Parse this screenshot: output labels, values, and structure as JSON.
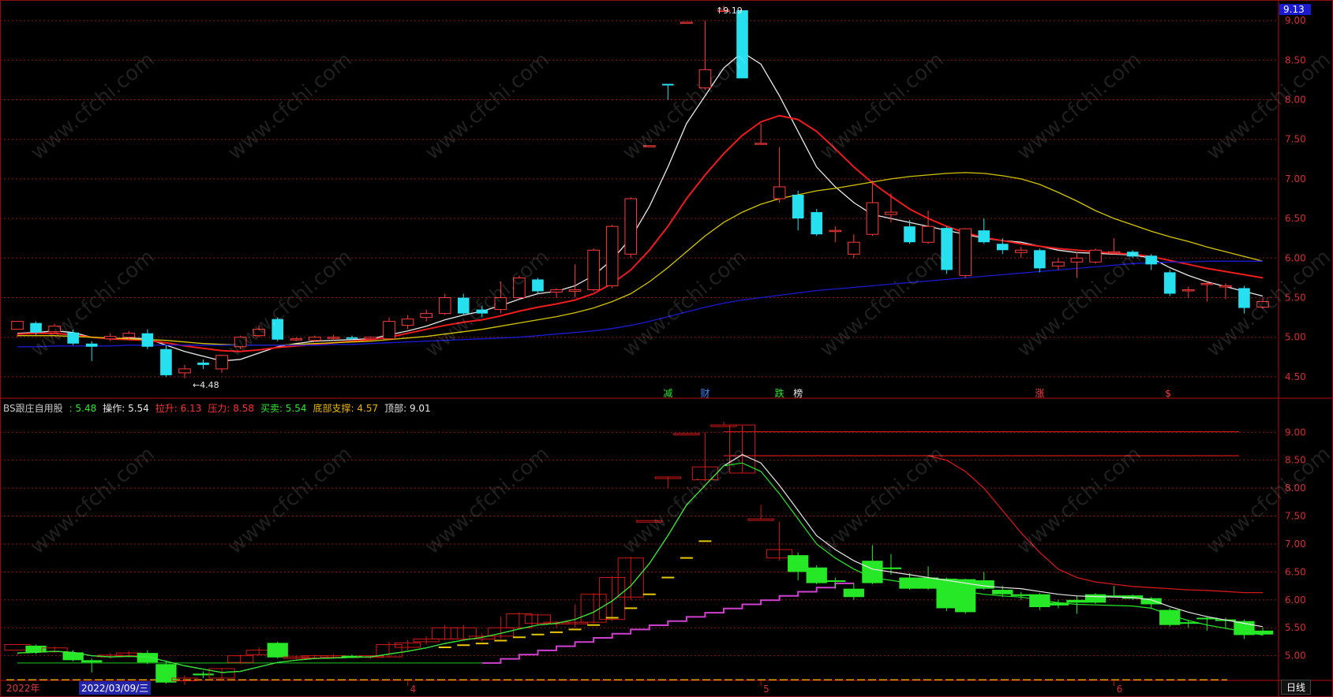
{
  "chart_data": [
    {
      "type": "candlestick",
      "panel": "main",
      "y_ticks": [
        "9.00",
        "8.50",
        "8.00",
        "7.50",
        "7.00",
        "6.50",
        "6.00",
        "5.50",
        "5.00",
        "4.50"
      ],
      "ylim": [
        4.3,
        9.2
      ],
      "current_price_tag": "9.13",
      "annotations": {
        "high": "9.19",
        "low": "4.48"
      },
      "event_markers": [
        {
          "text": "减",
          "color": "#2ee82e",
          "index": 35
        },
        {
          "text": "财",
          "color": "#3a8cff",
          "index": 37
        },
        {
          "text": "跌",
          "color": "#2ee82e",
          "index": 41
        },
        {
          "text": "榜",
          "color": "#e8e8e8",
          "index": 42
        },
        {
          "text": "涨",
          "color": "#ff4040",
          "index": 55
        },
        {
          "text": "$",
          "color": "#ff4040",
          "index": 62
        }
      ],
      "candles": [
        [
          5.1,
          5.2,
          5.04,
          5.0
        ],
        [
          5.18,
          5.06,
          5.2,
          5.03
        ],
        [
          5.07,
          5.14,
          5.17,
          5.05
        ],
        [
          5.06,
          4.92,
          5.1,
          4.9
        ],
        [
          4.92,
          4.88,
          4.95,
          4.7
        ],
        [
          4.98,
          5.01,
          5.05,
          4.95
        ],
        [
          5.0,
          5.05,
          5.08,
          4.97
        ],
        [
          5.05,
          4.88,
          5.1,
          4.85
        ],
        [
          4.85,
          4.52,
          4.9,
          4.5
        ],
        [
          4.55,
          4.6,
          4.65,
          4.48
        ],
        [
          4.68,
          4.65,
          4.72,
          4.6
        ],
        [
          4.6,
          4.77,
          4.78,
          4.55
        ],
        [
          4.88,
          5.0,
          5.02,
          4.85
        ],
        [
          5.02,
          5.1,
          5.15,
          5.0
        ],
        [
          5.23,
          4.97,
          5.25,
          4.95
        ],
        [
          4.97,
          4.98,
          5.0,
          4.95
        ],
        [
          4.96,
          5.0,
          5.02,
          4.94
        ],
        [
          5.0,
          5.0,
          5.03,
          4.96
        ],
        [
          5.0,
          4.98,
          5.02,
          4.96
        ],
        [
          4.98,
          5.0,
          5.01,
          4.95
        ],
        [
          4.98,
          5.2,
          5.25,
          4.97
        ],
        [
          5.15,
          5.23,
          5.28,
          5.1
        ],
        [
          5.25,
          5.3,
          5.35,
          5.2
        ],
        [
          5.3,
          5.5,
          5.55,
          5.28
        ],
        [
          5.5,
          5.3,
          5.55,
          5.28
        ],
        [
          5.35,
          5.3,
          5.4,
          5.25
        ],
        [
          5.35,
          5.5,
          5.7,
          5.3
        ],
        [
          5.5,
          5.75,
          5.78,
          5.48
        ],
        [
          5.73,
          5.58,
          5.75,
          5.55
        ],
        [
          5.57,
          5.6,
          5.62,
          5.5
        ],
        [
          5.58,
          5.6,
          5.92,
          5.5
        ],
        [
          5.6,
          6.1,
          6.12,
          5.58
        ],
        [
          5.65,
          6.4,
          6.42,
          5.62
        ],
        [
          6.05,
          6.75,
          6.77,
          6.0
        ],
        [
          7.42,
          7.42,
          7.42,
          7.42
        ],
        [
          8.2,
          8.18,
          8.2,
          8.0
        ],
        [
          8.98,
          8.98,
          8.98,
          8.98
        ],
        [
          8.15,
          8.38,
          9.0,
          8.12
        ],
        [
          9.13,
          9.13,
          9.19,
          9.13
        ],
        [
          9.13,
          8.27,
          9.13,
          8.27
        ],
        [
          7.45,
          7.45,
          7.7,
          7.45
        ],
        [
          6.75,
          6.9,
          7.4,
          6.7
        ],
        [
          6.8,
          6.5,
          6.85,
          6.35
        ],
        [
          6.58,
          6.3,
          6.62,
          6.28
        ],
        [
          6.35,
          6.35,
          6.4,
          6.2
        ],
        [
          6.05,
          6.2,
          6.3,
          6.0
        ],
        [
          6.3,
          6.7,
          6.98,
          6.28
        ],
        [
          6.55,
          6.58,
          6.82,
          6.45
        ],
        [
          6.4,
          6.2,
          6.48,
          6.18
        ],
        [
          6.2,
          6.4,
          6.6,
          6.18
        ],
        [
          6.38,
          5.85,
          6.4,
          5.8
        ],
        [
          5.78,
          6.37,
          6.38,
          5.75
        ],
        [
          6.35,
          6.2,
          6.5,
          6.18
        ],
        [
          6.18,
          6.1,
          6.25,
          6.05
        ],
        [
          6.07,
          6.1,
          6.14,
          6.0
        ],
        [
          6.1,
          5.87,
          6.12,
          5.82
        ],
        [
          5.9,
          5.95,
          6.0,
          5.85
        ],
        [
          5.95,
          6.0,
          6.08,
          5.75
        ],
        [
          5.95,
          6.1,
          6.12,
          5.93
        ],
        [
          6.08,
          6.08,
          6.25,
          6.05
        ],
        [
          6.08,
          6.02,
          6.1,
          6.0
        ],
        [
          6.03,
          5.92,
          6.05,
          5.85
        ],
        [
          5.82,
          5.55,
          5.85,
          5.52
        ],
        [
          5.6,
          5.6,
          5.64,
          5.5
        ],
        [
          5.68,
          5.68,
          5.7,
          5.45
        ],
        [
          5.65,
          5.65,
          5.68,
          5.48
        ],
        [
          5.62,
          5.37,
          5.65,
          5.3
        ],
        [
          5.38,
          5.45,
          5.5,
          5.36
        ]
      ],
      "moving_averages": [
        {
          "color": "#e8e8e8",
          "values": [
            5.05,
            5.06,
            5.08,
            5.06,
            5.0,
            4.98,
            4.99,
            4.98,
            4.9,
            4.82,
            4.76,
            4.7,
            4.72,
            4.8,
            4.88,
            4.92,
            4.95,
            4.96,
            4.97,
            4.98,
            5.03,
            5.08,
            5.14,
            5.22,
            5.28,
            5.33,
            5.4,
            5.48,
            5.55,
            5.58,
            5.65,
            5.78,
            5.98,
            6.25,
            6.65,
            7.15,
            7.7,
            8.05,
            8.4,
            8.6,
            8.45,
            8.05,
            7.6,
            7.15,
            6.9,
            6.7,
            6.55,
            6.5,
            6.45,
            6.4,
            6.35,
            6.3,
            6.25,
            6.22,
            6.2,
            6.15,
            6.1,
            6.07,
            6.06,
            6.05,
            6.04,
            6.0,
            5.88,
            5.78,
            5.7,
            5.64,
            5.58,
            5.52
          ]
        },
        {
          "color": "#ee1c1c",
          "values": [
            5.04,
            5.05,
            5.05,
            5.03,
            5.0,
            4.98,
            4.97,
            4.96,
            4.93,
            4.89,
            4.86,
            4.83,
            4.82,
            4.84,
            4.87,
            4.89,
            4.91,
            4.93,
            4.95,
            4.97,
            5.0,
            5.05,
            5.1,
            5.15,
            5.19,
            5.22,
            5.27,
            5.33,
            5.38,
            5.42,
            5.47,
            5.55,
            5.68,
            5.85,
            6.1,
            6.4,
            6.75,
            7.05,
            7.32,
            7.55,
            7.72,
            7.8,
            7.75,
            7.6,
            7.38,
            7.15,
            6.95,
            6.78,
            6.62,
            6.5,
            6.4,
            6.32,
            6.26,
            6.22,
            6.18,
            6.15,
            6.12,
            6.1,
            6.08,
            6.06,
            6.05,
            6.02,
            5.97,
            5.92,
            5.87,
            5.83,
            5.79,
            5.75
          ]
        },
        {
          "color": "#d4c400",
          "values": [
            5.02,
            5.02,
            5.02,
            5.01,
            5.0,
            4.99,
            4.98,
            4.97,
            4.96,
            4.94,
            4.92,
            4.91,
            4.9,
            4.9,
            4.9,
            4.91,
            4.92,
            4.93,
            4.94,
            4.95,
            4.97,
            4.99,
            5.01,
            5.04,
            5.07,
            5.1,
            5.14,
            5.18,
            5.22,
            5.26,
            5.31,
            5.37,
            5.45,
            5.55,
            5.7,
            5.88,
            6.08,
            6.28,
            6.45,
            6.58,
            6.68,
            6.75,
            6.8,
            6.85,
            6.88,
            6.92,
            6.96,
            7.0,
            7.03,
            7.05,
            7.07,
            7.08,
            7.07,
            7.04,
            7.0,
            6.93,
            6.83,
            6.72,
            6.6,
            6.5,
            6.42,
            6.34,
            6.27,
            6.21,
            6.14,
            6.08,
            6.02,
            5.96
          ]
        },
        {
          "color": "#1a1ad0",
          "values": [
            4.88,
            4.88,
            4.89,
            4.89,
            4.89,
            4.89,
            4.9,
            4.9,
            4.9,
            4.9,
            4.9,
            4.9,
            4.9,
            4.9,
            4.9,
            4.9,
            4.9,
            4.91,
            4.91,
            4.92,
            4.93,
            4.94,
            4.95,
            4.96,
            4.97,
            4.98,
            4.99,
            5.0,
            5.02,
            5.04,
            5.06,
            5.08,
            5.11,
            5.15,
            5.2,
            5.26,
            5.32,
            5.38,
            5.43,
            5.47,
            5.5,
            5.53,
            5.56,
            5.59,
            5.61,
            5.63,
            5.65,
            5.67,
            5.69,
            5.71,
            5.73,
            5.75,
            5.77,
            5.79,
            5.81,
            5.83,
            5.85,
            5.87,
            5.89,
            5.91,
            5.93,
            5.94,
            5.95,
            5.95,
            5.96,
            5.96,
            5.96,
            5.96
          ]
        }
      ]
    },
    {
      "type": "indicator",
      "panel": "sub",
      "name": "BS跟庄自用股",
      "legend": [
        {
          "label": "BS跟庄自用股",
          "value": "",
          "color": "#c8c8c8"
        },
        {
          "label": "",
          "value": ": 5.48",
          "color": "#2ee82e"
        },
        {
          "label": "操作",
          "value": ": 5.54",
          "color": "#e8e8e8"
        },
        {
          "label": "拉升",
          "value": ": 6.13",
          "color": "#ff3030"
        },
        {
          "label": "压力",
          "value": ": 8.58",
          "color": "#ff3030"
        },
        {
          "label": "买卖",
          "value": ": 5.54",
          "color": "#2ee82e"
        },
        {
          "label": "底部支撑",
          "value": ": 4.57",
          "color": "#e8b400"
        },
        {
          "label": "顶部",
          "value": ": 9.01",
          "color": "#e8e8e8"
        }
      ],
      "y_ticks": [
        "9.00",
        "8.50",
        "8.00",
        "7.50",
        "7.00",
        "6.50",
        "6.00",
        "5.50",
        "5.00"
      ],
      "ylim": [
        4.6,
        9.3
      ],
      "top_level": 9.01,
      "pressure_level": 8.58,
      "support_level": 4.57,
      "pull_up_line": [
        null,
        null,
        null,
        null,
        null,
        null,
        null,
        null,
        null,
        null,
        null,
        null,
        null,
        null,
        null,
        null,
        null,
        null,
        null,
        null,
        null,
        null,
        null,
        null,
        null,
        null,
        null,
        null,
        null,
        null,
        null,
        null,
        null,
        null,
        null,
        null,
        null,
        null,
        null,
        null,
        null,
        null,
        null,
        null,
        null,
        null,
        null,
        null,
        null,
        8.58,
        8.5,
        8.3,
        8.0,
        7.6,
        7.2,
        6.85,
        6.55,
        6.4,
        6.32,
        6.28,
        6.24,
        6.22,
        6.2,
        6.18,
        6.17,
        6.15,
        6.13,
        6.13
      ],
      "support_steps": [
        4.87,
        4.87,
        4.87,
        4.87,
        4.87,
        4.87,
        4.87,
        4.87,
        4.87,
        4.87,
        4.87,
        4.87,
        4.87,
        4.87,
        4.87,
        4.87,
        4.87,
        4.87,
        4.87,
        4.87,
        4.87,
        4.87,
        4.87,
        4.87,
        4.87,
        4.87,
        4.87,
        4.87,
        4.87,
        4.87,
        4.87,
        4.87,
        4.87,
        4.87,
        4.87,
        4.87,
        4.87,
        4.87,
        4.87,
        4.87,
        4.87,
        4.87,
        4.87,
        4.87,
        4.87,
        4.87,
        4.87,
        4.87,
        4.87,
        4.87,
        4.87,
        4.87,
        4.87,
        4.87,
        4.87,
        4.87,
        4.87,
        4.87,
        4.87,
        4.87,
        4.87,
        4.87,
        4.87,
        4.87,
        4.87,
        4.87,
        4.87,
        4.87
      ]
    }
  ],
  "x_axis": {
    "year_label": "2022年",
    "date_cursor": "2022/03/09/三",
    "month_ticks": [
      {
        "label": "4",
        "index": 21
      },
      {
        "label": "5",
        "index": 40
      },
      {
        "label": "6",
        "index": 59
      }
    ],
    "period": "日线"
  },
  "watermark": "www.cfchi.com"
}
